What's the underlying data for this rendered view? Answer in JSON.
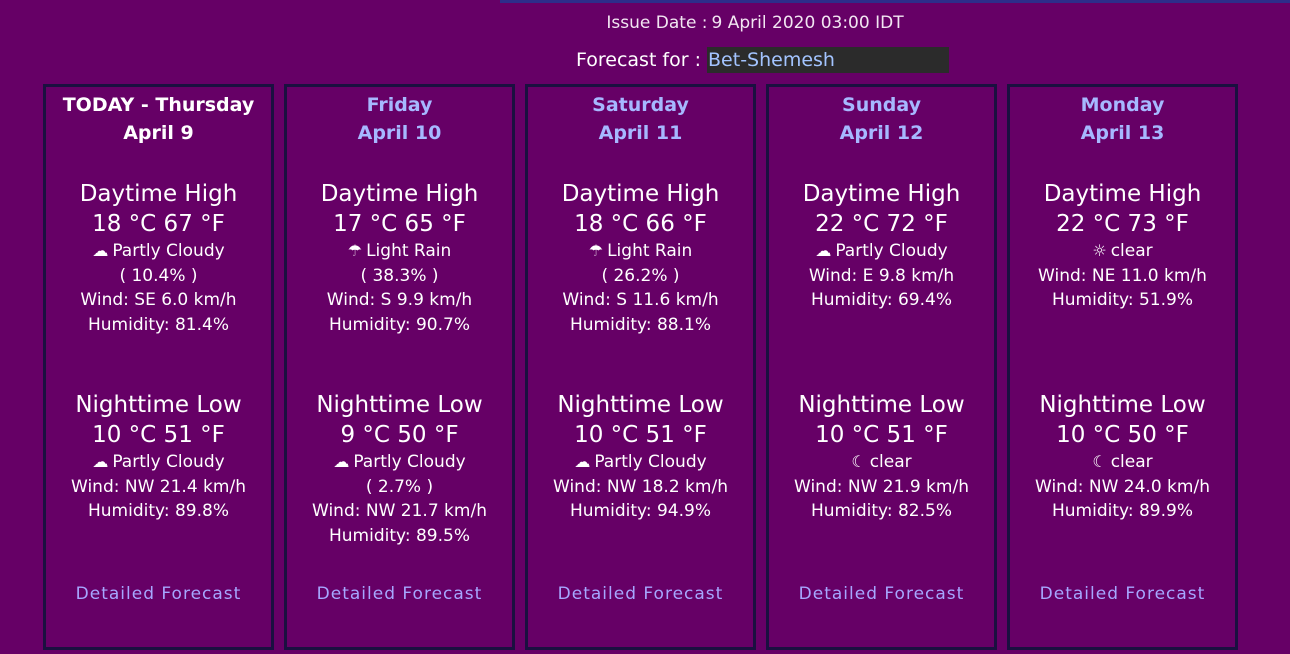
{
  "header": {
    "issue_label": "Issue Date :",
    "issue_value": "9 April 2020 03:00 IDT",
    "forecast_label": "Forecast for :",
    "location": "Bet-Shemesh"
  },
  "days": [
    {
      "name": "TODAY - Thursday",
      "date": "April 9",
      "day": {
        "title": "Daytime High",
        "temps": "18 °C 67 °F",
        "icon": "cloud-icon",
        "glyph": "☁",
        "condition": "Partly Cloudy",
        "precip": "( 10.4% )",
        "wind": "Wind: SE 6.0 km/h",
        "humidity": "Humidity: 81.4%"
      },
      "night": {
        "title": "Nighttime Low",
        "temps": "10 °C 51 °F",
        "icon": "cloud-icon",
        "glyph": "☁",
        "condition": "Partly Cloudy",
        "precip": "",
        "wind": "Wind: NW 21.4 km/h",
        "humidity": "Humidity: 89.8%"
      },
      "link": "Detailed Forecast"
    },
    {
      "name": "Friday",
      "date": "April 10",
      "day": {
        "title": "Daytime High",
        "temps": "17 °C 65 °F",
        "icon": "umbrella-icon",
        "glyph": "☂",
        "condition": "Light Rain",
        "precip": "( 38.3% )",
        "wind": "Wind: S 9.9 km/h",
        "humidity": "Humidity: 90.7%"
      },
      "night": {
        "title": "Nighttime Low",
        "temps": "9 °C 50 °F",
        "icon": "cloud-icon",
        "glyph": "☁",
        "condition": "Partly Cloudy",
        "precip": "( 2.7% )",
        "wind": "Wind: NW 21.7 km/h",
        "humidity": "Humidity: 89.5%"
      },
      "link": "Detailed Forecast"
    },
    {
      "name": "Saturday",
      "date": "April 11",
      "day": {
        "title": "Daytime High",
        "temps": "18 °C 66 °F",
        "icon": "umbrella-icon",
        "glyph": "☂",
        "condition": "Light Rain",
        "precip": "( 26.2% )",
        "wind": "Wind: S 11.6 km/h",
        "humidity": "Humidity: 88.1%"
      },
      "night": {
        "title": "Nighttime Low",
        "temps": "10 °C 51 °F",
        "icon": "cloud-icon",
        "glyph": "☁",
        "condition": "Partly Cloudy",
        "precip": "",
        "wind": "Wind: NW 18.2 km/h",
        "humidity": "Humidity: 94.9%"
      },
      "link": "Detailed Forecast"
    },
    {
      "name": "Sunday",
      "date": "April 12",
      "day": {
        "title": "Daytime High",
        "temps": "22 °C 72 °F",
        "icon": "cloud-icon",
        "glyph": "☁",
        "condition": "Partly Cloudy",
        "precip": "",
        "wind": "Wind: E 9.8 km/h",
        "humidity": "Humidity: 69.4%"
      },
      "night": {
        "title": "Nighttime Low",
        "temps": "10 °C 51 °F",
        "icon": "moon-icon",
        "glyph": "☾",
        "condition": "clear",
        "precip": "",
        "wind": "Wind: NW 21.9 km/h",
        "humidity": "Humidity: 82.5%"
      },
      "link": "Detailed Forecast"
    },
    {
      "name": "Monday",
      "date": "April 13",
      "day": {
        "title": "Daytime High",
        "temps": "22 °C 73 °F",
        "icon": "sun-icon",
        "glyph": "☼",
        "condition": "clear",
        "precip": "",
        "wind": "Wind: NE 11.0 km/h",
        "humidity": "Humidity: 51.9%"
      },
      "night": {
        "title": "Nighttime Low",
        "temps": "10 °C 50 °F",
        "icon": "moon-icon",
        "glyph": "☾",
        "condition": "clear",
        "precip": "",
        "wind": "Wind: NW 24.0 km/h",
        "humidity": "Humidity: 89.9%"
      },
      "link": "Detailed Forecast"
    }
  ],
  "colors": {
    "background": "#660066",
    "column_border": "#1a1040",
    "day_heading": "#a6b8ff",
    "link": "#a6a6ff",
    "location_box": "#2b2b2b",
    "location_text": "#a3c4ff"
  }
}
